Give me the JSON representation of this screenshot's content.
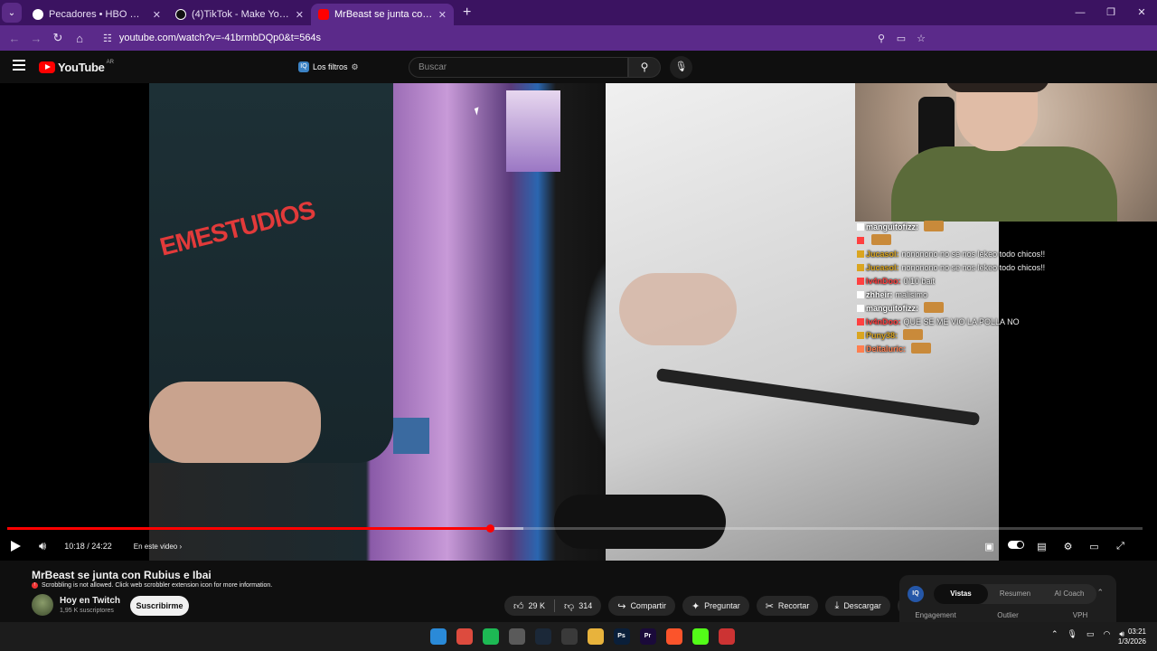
{
  "browser": {
    "tabs": [
      {
        "title": "Pecadores • HBO Max",
        "active": false,
        "favicon_color": "#ffffff"
      },
      {
        "title": "(4)TikTok - Make Your Day",
        "active": false,
        "favicon_color": "#000000"
      },
      {
        "title": "MrBeast se junta con Rubius e Ibai",
        "active": true,
        "favicon_color": "#ff0000"
      }
    ],
    "new_tab": "+",
    "url": "youtube.com/watch?v=-41brmbDQp0&t=564s",
    "window_controls": [
      "—",
      "❐",
      "✕"
    ]
  },
  "youtube": {
    "logo_text": "YouTube",
    "country_code": "AR",
    "filters_label": "Los filtros",
    "search_placeholder": "Buscar"
  },
  "player": {
    "time": "10:18 / 24:22",
    "chapters_label": "En este video",
    "progress": 0.425,
    "buffered": 0.455,
    "shirt_logo": "EMESTUDIOS"
  },
  "chat": [
    {
      "user": "manguitofizz:",
      "text": "",
      "user_color": "#ffffff",
      "emote": true
    },
    {
      "user": "",
      "text": "",
      "user_color": "#ff4040",
      "emote": true
    },
    {
      "user": "Jucasol:",
      "text": "nononono no se nos lekeo todo chicos!!",
      "user_color": "#daa520",
      "emote": false
    },
    {
      "user": "Jucasol:",
      "text": "nononono no se nos lekeo todo chicos!!",
      "user_color": "#daa520",
      "emote": false
    },
    {
      "user": "Iv4nDoo:",
      "text": "0/10 bait",
      "user_color": "#ff4040",
      "emote": false
    },
    {
      "user": "zhheir:",
      "text": "malisimo",
      "user_color": "#ffffff",
      "emote": false
    },
    {
      "user": "manguitofizz:",
      "text": "",
      "user_color": "#ffffff",
      "emote": true
    },
    {
      "user": "Iv4nDoo:",
      "text": "QUE SE ME VIO LA POLLA NO",
      "user_color": "#ff4040",
      "emote": false
    },
    {
      "user": "Puny38:",
      "text": "",
      "user_color": "#daa520",
      "emote": true
    },
    {
      "user": "Deltaluric:",
      "text": "",
      "user_color": "#ff7f50",
      "emote": true
    }
  ],
  "video": {
    "title": "MrBeast se junta con Rubius e Ibai",
    "scrobble_notice": "Scrobbling is not allowed. Click web scrobbler extension icon for more information.",
    "channel": "Hoy en Twitch",
    "subscribers": "1,95 K suscriptores",
    "subscribe_label": "Suscribirme",
    "likes": "29 K",
    "dislikes": "314",
    "share_label": "Compartir",
    "ask_label": "Preguntar",
    "clip_label": "Recortar",
    "download_label": "Descargar"
  },
  "side_panel": {
    "logo": "IQ",
    "tabs": [
      "Vistas",
      "Resumen",
      "AI Coach"
    ],
    "active_tab": "Vistas",
    "columns": [
      "Engagement",
      "Outlier",
      "VPH"
    ]
  },
  "taskbar": {
    "apps": [
      {
        "name": "windows-start",
        "color": "#2a8ad8",
        "label": ""
      },
      {
        "name": "chrome",
        "color": "#dd4b3e",
        "label": ""
      },
      {
        "name": "spotify",
        "color": "#1db954",
        "label": ""
      },
      {
        "name": "whatsapp-like",
        "color": "#5a5a5a",
        "label": ""
      },
      {
        "name": "steam",
        "color": "#1b2838",
        "label": ""
      },
      {
        "name": "chrome-alt",
        "color": "#3a3a3a",
        "label": ""
      },
      {
        "name": "file-explorer",
        "color": "#e8b33c",
        "label": ""
      },
      {
        "name": "photoshop",
        "color": "#0a1f3a",
        "label": "Ps"
      },
      {
        "name": "premiere",
        "color": "#1a0a3a",
        "label": "Pr"
      },
      {
        "name": "brave",
        "color": "#fb542b",
        "label": ""
      },
      {
        "name": "kick",
        "color": "#53fc18",
        "label": ""
      },
      {
        "name": "voice-app",
        "color": "#c33",
        "label": ""
      }
    ],
    "time": "03:21",
    "date": "1/3/2026"
  }
}
